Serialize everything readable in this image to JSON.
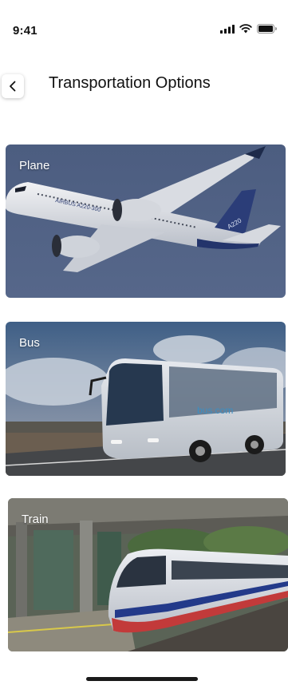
{
  "status": {
    "time": "9:41"
  },
  "header": {
    "title": "Transportation Options"
  },
  "cards": [
    {
      "label": "Plane",
      "fuselage_text": "AIRBUS A220-300",
      "tail_text": "A220"
    },
    {
      "label": "Bus",
      "side_text": "bus.com"
    },
    {
      "label": "Train"
    }
  ]
}
